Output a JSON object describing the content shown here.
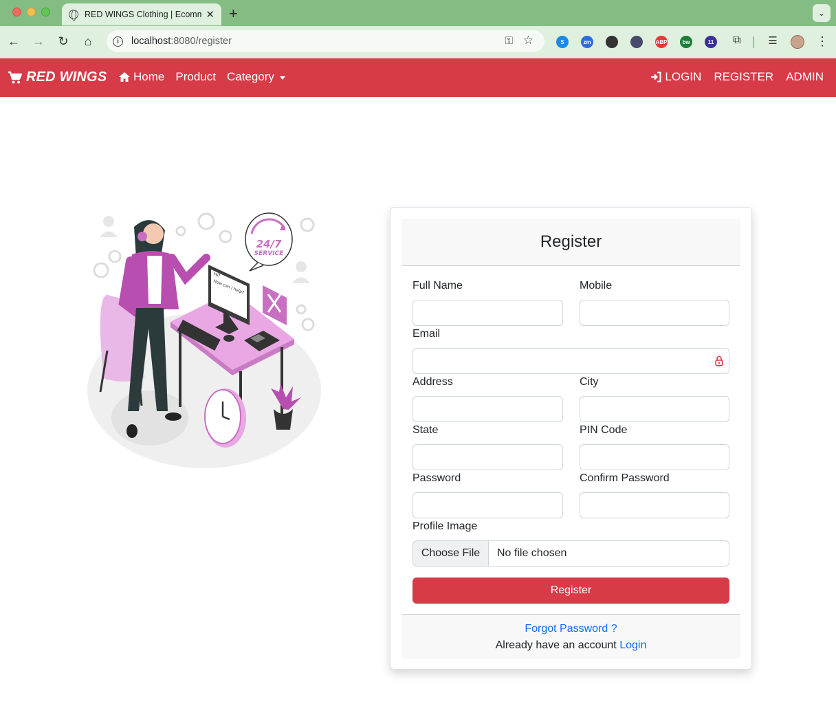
{
  "browser": {
    "tab_title": "RED WINGS Clothing | Ecomm",
    "url_host": "localhost",
    "url_path": ":8080/register",
    "extensions": [
      {
        "name": "sync-extension-icon",
        "color": "#1e88e5",
        "label": "S"
      },
      {
        "name": "zoom-extension-icon",
        "color": "#2d6cdf",
        "label": "zm"
      },
      {
        "name": "color-picker-extension-icon",
        "color": "#333333",
        "label": ""
      },
      {
        "name": "emoji-extension-icon",
        "color": "#4a4a6a",
        "label": ""
      },
      {
        "name": "adblock-extension-icon",
        "color": "#e53935",
        "label": "ABP"
      },
      {
        "name": "bw-extension-icon",
        "color": "#1a7f37",
        "label": "bw"
      },
      {
        "name": "badge-extension-icon",
        "color": "#3d2fa0",
        "label": "11"
      }
    ]
  },
  "navbar": {
    "brand": "RED WINGS",
    "home": "Home",
    "product": "Product",
    "category": "Category",
    "login": "LOGIN",
    "register": "REGISTER",
    "admin": "ADMIN",
    "color": "#d63b47"
  },
  "illustration": {
    "badge_text_top": "24/7",
    "badge_text_bottom": "SERVICE"
  },
  "form": {
    "title": "Register",
    "full_name_label": "Full Name",
    "mobile_label": "Mobile",
    "email_label": "Email",
    "address_label": "Address",
    "city_label": "City",
    "state_label": "State",
    "pin_label": "PIN Code",
    "password_label": "Password",
    "confirm_password_label": "Confirm Password",
    "profile_image_label": "Profile Image",
    "choose_file": "Choose File",
    "no_file": "No file chosen",
    "submit_label": "Register",
    "values": {
      "full_name": "",
      "mobile": "",
      "email": "",
      "address": "",
      "city": "",
      "state": "",
      "pin": "",
      "password": "",
      "confirm_password": ""
    }
  },
  "footer": {
    "forgot_password": "Forgot Password ?",
    "already_text": "Already have an account",
    "login_link": "Login"
  }
}
